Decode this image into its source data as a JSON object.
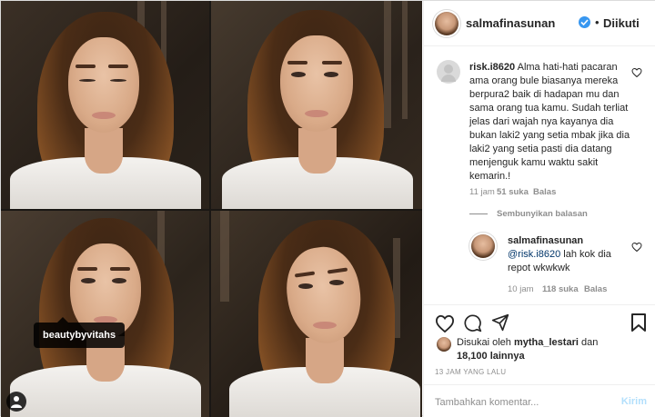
{
  "header": {
    "username": "salmafinasunan",
    "dot": "•",
    "follow_status": "Diikuti",
    "verified_icon": "verified-badge-icon"
  },
  "media": {
    "tag_label": "beautybyvitahs",
    "tiles": [
      "eyes-closed-portrait",
      "front-portrait",
      "front-portrait-tagged",
      "tilted-portrait"
    ]
  },
  "comments": [
    {
      "user": "risk.i8620",
      "text": "Alma hati-hati pacaran ama orang bule biasanya mereka berpura2 baik di hadapan mu dan sama orang tua kamu. Sudah terliat jelas dari wajah nya kayanya dia bukan laki2 yang setia mbak jika dia laki2 yang setia pasti dia datang menjenguk kamu waktu sakit kemarin.!",
      "time": "11 jam",
      "likes": "51 suka",
      "reply": "Balas"
    }
  ],
  "hide_replies_label": "Sembunyikan balasan",
  "reply": {
    "user": "salmafinasunan",
    "mention": "@risk.i8620",
    "text": " lah kok dia repot wkwkwk",
    "time": "10 jam",
    "likes": "118 suka",
    "reply": "Balas"
  },
  "liked_by": {
    "prefix": "Disukai oleh ",
    "user": "mytha_lestari",
    "middle": " dan",
    "count": "18,100 lainnya"
  },
  "time_ago": "13 JAM YANG LALU",
  "composer": {
    "placeholder": "Tambahkan komentar...",
    "post_label": "Kirim"
  },
  "colors": {
    "accent": "#3897f0",
    "post_disabled": "#b2dffc",
    "secondary_text": "#8e8e8e",
    "border": "#dbdbdb"
  }
}
